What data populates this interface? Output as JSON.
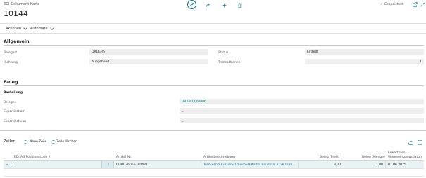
{
  "header": {
    "breadcrumb": "EDI-Dokument-Karte",
    "record_no": "10144",
    "saved_status": "Gespeichert"
  },
  "actions": {
    "actions_label": "Aktionen",
    "automate_label": "Automate"
  },
  "general": {
    "section_title": "Allgemein",
    "belegart_label": "Belegart",
    "belegart_value": "ORDERS",
    "richtung_label": "Richtung",
    "richtung_value": "Ausgehend",
    "status_label": "Status",
    "status_value": "Erstellt",
    "transaktionen_label": "Transaktionen",
    "transaktionen_value": "1"
  },
  "beleg": {
    "section_title": "Beleg",
    "subgroup_title": "Bestellung",
    "belegnr_label": "Belegnr.",
    "belegnr_value": "UB2400000006",
    "exportiert_am_label": "Exportiert am",
    "exportiert_am_value": "_",
    "exportiert_von_label": "Exportiert von",
    "exportiert_von_value": "_"
  },
  "lines": {
    "title": "Zeilen",
    "new_line_label": "Neue Zeile",
    "delete_line_label": "Zeile löschen",
    "columns": [
      "EDI AB Positionscode ↑",
      "Artikel Nr.",
      "Artikelbeschreibung",
      "Beleg (Preis)",
      "Beleg (Menge)",
      "Erwartetes Wareneingangsdatum"
    ],
    "rows": [
      {
        "code": "1",
        "artikel_nr": "COAT-760557804871",
        "beschreibung": "Transcend TS2GUSD microSD-Karte Industrial 2 GB Class ...",
        "preis": "3,00",
        "menge": "1,00",
        "datum": "01.06.2025"
      }
    ]
  },
  "colors": {
    "accent": "#00798a",
    "field_bg": "#eeeeee",
    "selected_row": "#e8f3f5"
  }
}
